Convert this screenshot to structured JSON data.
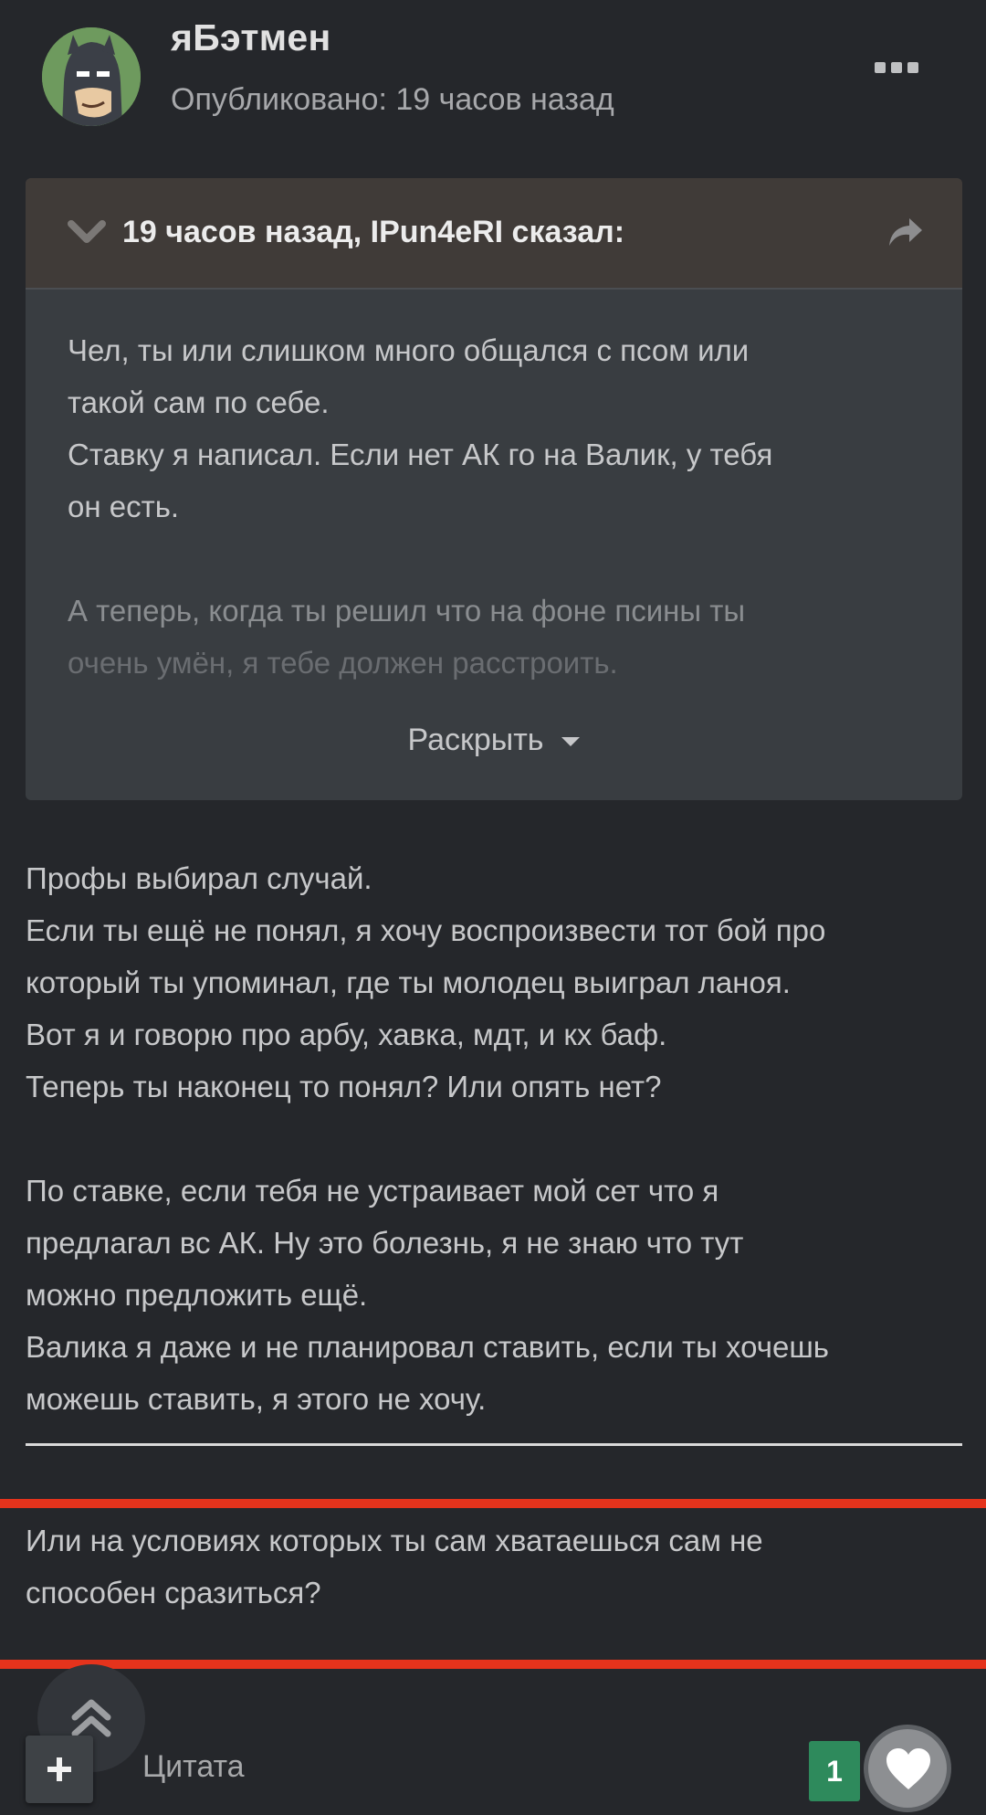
{
  "post": {
    "author": "яБэтмен",
    "published": "Опубликовано: 19 часов назад"
  },
  "quote": {
    "citation": "19 часов назад, IPun4eRI сказал:",
    "lines": [
      "Чел, ты или слишком много общался с псом или",
      "такой сам по себе.",
      "Ставку я написал. Если нет АК го на Валик, у тебя",
      "он есть.",
      "А теперь, когда ты решил что на фоне псины ты",
      "очень умён, я тебе должен расстроить."
    ],
    "expand_label": "Раскрыть"
  },
  "body": {
    "paragraph1": [
      "Профы выбирал случай.",
      "Если ты ещё не понял, я хочу воспроизвести тот бой про",
      "который ты упоминал, где ты молодец выиграл ланоя.",
      "Вот я и говорю про арбу, хавка, мдт, и кх баф.",
      "Теперь ты наконец то понял? Или опять нет?"
    ],
    "paragraph2": [
      "По ставке, если тебя не устраивает мой сет что я",
      "предлагал вс АК. Ну это болезнь, я не знаю что тут",
      "можно предложить ещё.",
      "Валика я даже и не планировал ставить, если ты хочешь",
      "можешь ставить, я этого не хочу."
    ],
    "highlighted": [
      "Или на условиях которых ты сам хватаешься сам не",
      "способен сразиться?"
    ]
  },
  "footer": {
    "quote_label": "Цитата",
    "reaction_count": "1"
  },
  "colors": {
    "background": "#25272b",
    "quote_background": "#393d41",
    "quote_header": "#403b38",
    "highlight_border": "#e5331c",
    "reaction_badge": "#2e8a5c"
  },
  "icons": {
    "more": "more-dots-icon",
    "collapse": "chevron-down-icon",
    "share": "share-arrow-icon",
    "scroll_top": "double-chevron-up-icon",
    "add": "plus-icon",
    "like": "heart-icon"
  }
}
